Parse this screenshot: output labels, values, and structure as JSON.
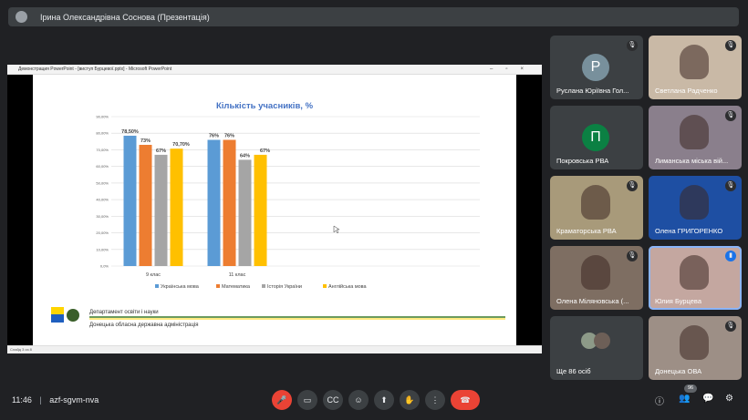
{
  "presenter": {
    "title": "Ірина Олександрівна Соснова (Презентація)"
  },
  "ppt_window": {
    "title": "Демонстрация PowerPoint - [виступ Бурцевої.pptx] - Microsoft PowerPoint",
    "controls": "–▫×",
    "status": "Слайд 3 из 8"
  },
  "slide": {
    "footer_dept": "Департамент освіти і науки",
    "footer_admin": "Донецька обласна державна адміністрація"
  },
  "chart_data": {
    "type": "bar",
    "title": "Кількість учасників, %",
    "categories": [
      "9 клас",
      "11 клас"
    ],
    "series": [
      {
        "name": "Українська мова",
        "color": "#5b9bd5",
        "values": [
          78.5,
          76
        ],
        "labels": [
          "78,50%",
          "76%"
        ]
      },
      {
        "name": "Математика",
        "color": "#ed7d31",
        "values": [
          73,
          76
        ],
        "labels": [
          "73%",
          "76%"
        ]
      },
      {
        "name": "Історія України",
        "color": "#a5a5a5",
        "values": [
          67,
          64
        ],
        "labels": [
          "67%",
          "64%"
        ]
      },
      {
        "name": "Англійська мова",
        "color": "#ffc000",
        "values": [
          70.7,
          67
        ],
        "labels": [
          "70,70%",
          "67%"
        ]
      }
    ],
    "yticks": [
      "0,0%",
      "10,00%",
      "20,00%",
      "30,00%",
      "40,00%",
      "50,00%",
      "60,00%",
      "70,00%",
      "80,00%",
      "90,00%"
    ],
    "ylim": [
      0,
      90
    ],
    "grid": true,
    "legend": "bottom"
  },
  "participants": [
    {
      "name": "Руслана Юріївна Гол...",
      "initial": "Р",
      "color": "#78909c",
      "muted": true,
      "video": false
    },
    {
      "name": "Светлана Радченко",
      "muted": true,
      "video": true,
      "bg": "#c9b9a6"
    },
    {
      "name": "Покровська РВА",
      "initial": "П",
      "color": "#0b8043",
      "muted": false,
      "video": false
    },
    {
      "name": "Лиманська міська вій...",
      "muted": true,
      "video": true,
      "bg": "#8a7f8c"
    },
    {
      "name": "Краматорська РВА",
      "muted": true,
      "video": true,
      "bg": "#a89a7a"
    },
    {
      "name": "Олена ГРИГОРЕНКО",
      "muted": true,
      "video": true,
      "bg": "#1e4fa3"
    },
    {
      "name": "Олена Міляновська (...",
      "muted": true,
      "video": true,
      "bg": "#7e6e62"
    },
    {
      "name": "Юлия Бурцева",
      "muted": false,
      "video": true,
      "bg": "#c4a7a0"
    },
    {
      "name": "Ще 86 осіб",
      "muted": false,
      "video": false
    },
    {
      "name": "Донецька ОВА",
      "muted": true,
      "video": true,
      "bg": "#9d8f86"
    }
  ],
  "bottom": {
    "time": "11:46",
    "meeting_code": "azf-sgvm-nva",
    "people_count": "96"
  }
}
